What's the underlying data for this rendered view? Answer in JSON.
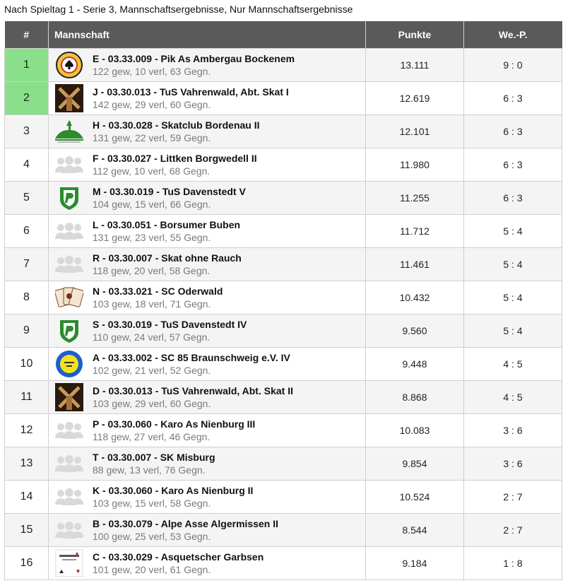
{
  "page_title": "Nach Spieltag 1 - Serie 3, Mannschaftsergebnisse, Nur Mannschaftsergebnisse",
  "table": {
    "headers": {
      "rank": "#",
      "team": "Mannschaft",
      "points": "Punkte",
      "we_p": "We.-P."
    },
    "rows": [
      {
        "rank": "1",
        "logo": "bockenem-logo",
        "name": "E - 03.33.009 - Pik As Ambergau Bockenem",
        "stats": "122 gew, 10 verl, 63 Gegn.",
        "points": "13.111",
        "wep": "9 : 0",
        "highlight": true
      },
      {
        "rank": "2",
        "logo": "windmill-logo",
        "name": "J - 03.30.013 - TuS Vahrenwald, Abt. Skat I",
        "stats": "142 gew, 29 verl, 60 Gegn.",
        "points": "12.619",
        "wep": "6 : 3",
        "highlight": true
      },
      {
        "rank": "3",
        "logo": "bordenau-logo",
        "name": "H - 03.30.028 - Skatclub Bordenau II",
        "stats": "131 gew, 22 verl, 59 Gegn.",
        "points": "12.101",
        "wep": "6 : 3",
        "highlight": false
      },
      {
        "rank": "4",
        "logo": "group-icon",
        "name": "F - 03.30.027 - Littken Borgwedell II",
        "stats": "112 gew, 10 verl, 68 Gegn.",
        "points": "11.980",
        "wep": "6 : 3",
        "highlight": false
      },
      {
        "rank": "5",
        "logo": "shield-logo",
        "name": "M - 03.30.019 - TuS Davenstedt V",
        "stats": "104 gew, 15 verl, 66 Gegn.",
        "points": "11.255",
        "wep": "6 : 3",
        "highlight": false
      },
      {
        "rank": "6",
        "logo": "group-icon",
        "name": "L - 03.30.051 - Borsumer Buben",
        "stats": "131 gew, 23 verl, 55 Gegn.",
        "points": "11.712",
        "wep": "5 : 4",
        "highlight": false
      },
      {
        "rank": "7",
        "logo": "group-icon",
        "name": "R - 03.30.007 - Skat ohne Rauch",
        "stats": "118 gew, 20 verl, 58 Gegn.",
        "points": "11.461",
        "wep": "5 : 4",
        "highlight": false
      },
      {
        "rank": "8",
        "logo": "cards-logo",
        "name": "N - 03.33.021 - SC Oderwald",
        "stats": "103 gew, 18 verl, 71 Gegn.",
        "points": "10.432",
        "wep": "5 : 4",
        "highlight": false
      },
      {
        "rank": "9",
        "logo": "shield-logo",
        "name": "S - 03.30.019 - TuS Davenstedt IV",
        "stats": "110 gew, 24 verl, 57 Gegn.",
        "points": "9.560",
        "wep": "5 : 4",
        "highlight": false
      },
      {
        "rank": "10",
        "logo": "braunschweig-logo",
        "name": "A - 03.33.002 - SC 85 Braunschweig e.V. IV",
        "stats": "102 gew, 21 verl, 52 Gegn.",
        "points": "9.448",
        "wep": "4 : 5",
        "highlight": false
      },
      {
        "rank": "11",
        "logo": "windmill-logo",
        "name": "D - 03.30.013 - TuS Vahrenwald, Abt. Skat II",
        "stats": "103 gew, 29 verl, 60 Gegn.",
        "points": "8.868",
        "wep": "4 : 5",
        "highlight": false
      },
      {
        "rank": "12",
        "logo": "group-icon",
        "name": "P - 03.30.060 - Karo As Nienburg III",
        "stats": "118 gew, 27 verl, 46 Gegn.",
        "points": "10.083",
        "wep": "3 : 6",
        "highlight": false
      },
      {
        "rank": "13",
        "logo": "group-icon",
        "name": "T - 03.30.007 - SK Misburg",
        "stats": "88 gew, 13 verl, 76 Gegn.",
        "points": "9.854",
        "wep": "3 : 6",
        "highlight": false
      },
      {
        "rank": "14",
        "logo": "group-icon",
        "name": "K - 03.30.060 - Karo As Nienburg II",
        "stats": "103 gew, 15 verl, 58 Gegn.",
        "points": "10.524",
        "wep": "2 : 7",
        "highlight": false
      },
      {
        "rank": "15",
        "logo": "group-icon",
        "name": "B - 03.30.079 - Alpe Asse Algermissen II",
        "stats": "100 gew, 25 verl, 53 Gegn.",
        "points": "8.544",
        "wep": "2 : 7",
        "highlight": false
      },
      {
        "rank": "16",
        "logo": "asquetscher-logo",
        "name": "C - 03.30.029 - Asquetscher Garbsen",
        "stats": "101 gew, 20 verl, 61 Gegn.",
        "points": "9.184",
        "wep": "1 : 8",
        "highlight": false
      }
    ]
  },
  "colors": {
    "header_bg": "#5a5a5a",
    "highlight_rank": "#8ae08a",
    "stats_text": "#7a7a7a",
    "logo_green": "#2e8b2e"
  }
}
